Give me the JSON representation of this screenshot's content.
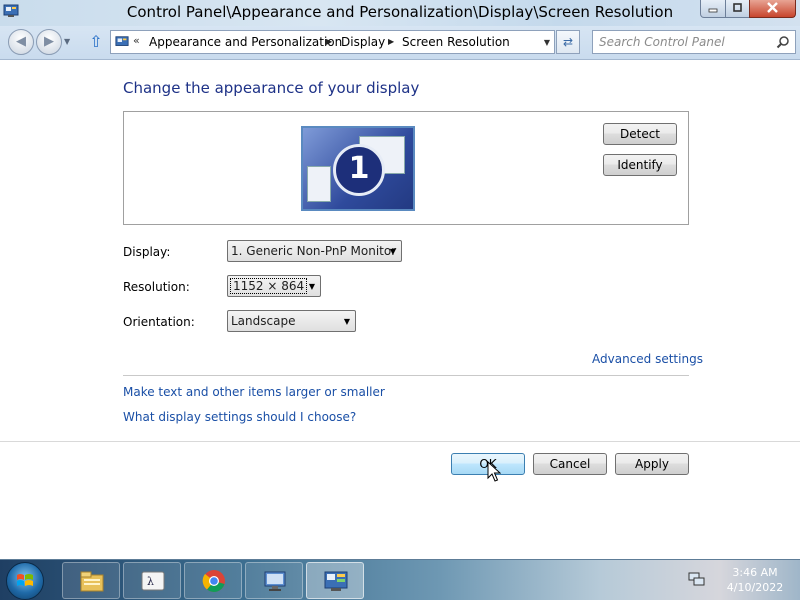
{
  "window": {
    "title": "Control Panel\\Appearance and Personalization\\Display\\Screen Resolution",
    "icon": "control-panel-icon"
  },
  "address_bar": {
    "breadcrumbs": [
      "Appearance and Personalization",
      "Display",
      "Screen Resolution"
    ],
    "search_placeholder": "Search Control Panel"
  },
  "main": {
    "heading": "Change the appearance of your display",
    "monitor_number": "1",
    "detect_label": "Detect",
    "identify_label": "Identify",
    "display_label": "Display:",
    "display_value": "1. Generic Non-PnP Monitor",
    "resolution_label": "Resolution:",
    "resolution_value": "1152 × 864",
    "orientation_label": "Orientation:",
    "orientation_value": "Landscape",
    "advanced_link": "Advanced settings",
    "text_size_link": "Make text and other items larger or smaller",
    "help_link": "What display settings should I choose?",
    "ok_label": "OK",
    "cancel_label": "Cancel",
    "apply_label": "Apply"
  },
  "taskbar": {
    "items": [
      "file-explorer-icon",
      "language-bar-icon",
      "chrome-icon",
      "display-settings-icon",
      "control-panel-icon"
    ],
    "active_index": 4,
    "time": "3:46 AM",
    "date": "4/10/2022"
  },
  "colors": {
    "heading": "#1e3287",
    "link": "#1a4fa6",
    "taskbar": "#3b6d8f"
  }
}
